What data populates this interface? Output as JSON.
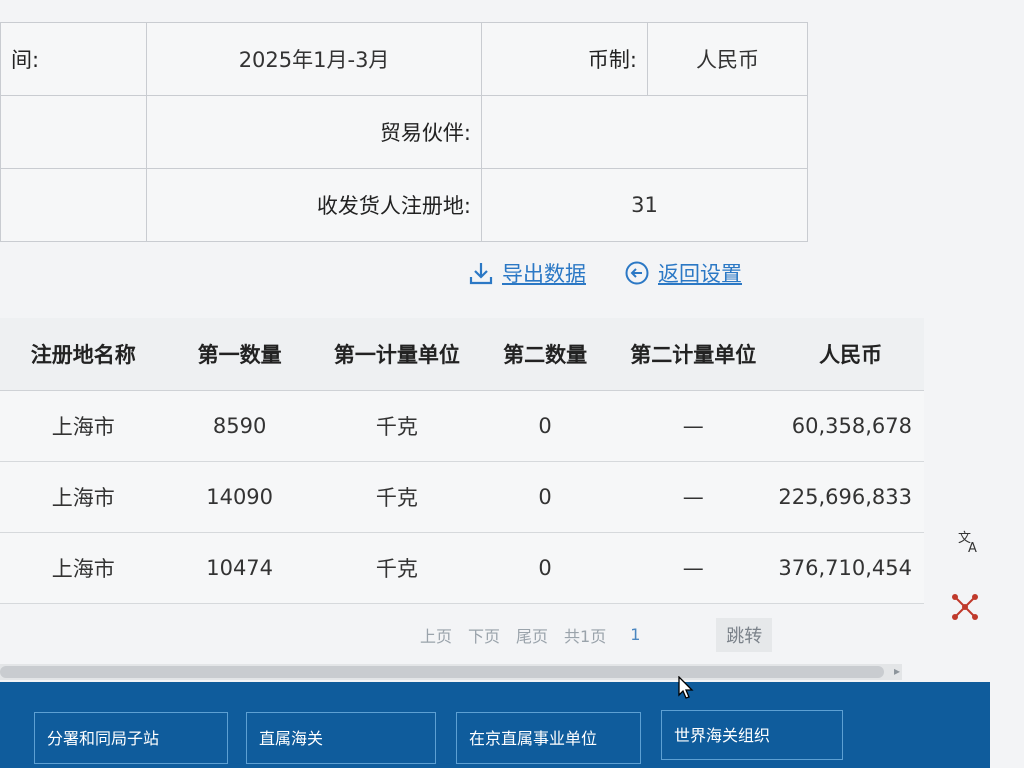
{
  "criteria": {
    "period_label": "间:",
    "period_value": "2025年1月-3月",
    "currency_label": "币制:",
    "currency_value": "人民币",
    "partner_label": "贸易伙伴:",
    "partner_value": "",
    "consignee_label": "收发货人注册地:",
    "consignee_value": "31"
  },
  "actions": {
    "export_label": "导出数据",
    "back_label": "返回设置"
  },
  "table": {
    "headers": [
      "注册地名称",
      "第一数量",
      "第一计量单位",
      "第二数量",
      "第二计量单位",
      "人民币"
    ],
    "rows": [
      [
        "上海市",
        "8590",
        "千克",
        "0",
        "—",
        "60,358,678"
      ],
      [
        "上海市",
        "14090",
        "千克",
        "0",
        "—",
        "225,696,833"
      ],
      [
        "上海市",
        "10474",
        "千克",
        "0",
        "—",
        "376,710,454"
      ]
    ]
  },
  "pager": {
    "prev": "上页",
    "next": "下页",
    "last": "尾页",
    "total": "共1页",
    "page_input": "1",
    "jump": "跳转"
  },
  "footer": {
    "links": [
      "分署和同局子站",
      "直属海关",
      "在京直属事业单位",
      "世界海关组织"
    ]
  },
  "icons": {
    "translate": "translate-icon",
    "network": "network-icon"
  }
}
